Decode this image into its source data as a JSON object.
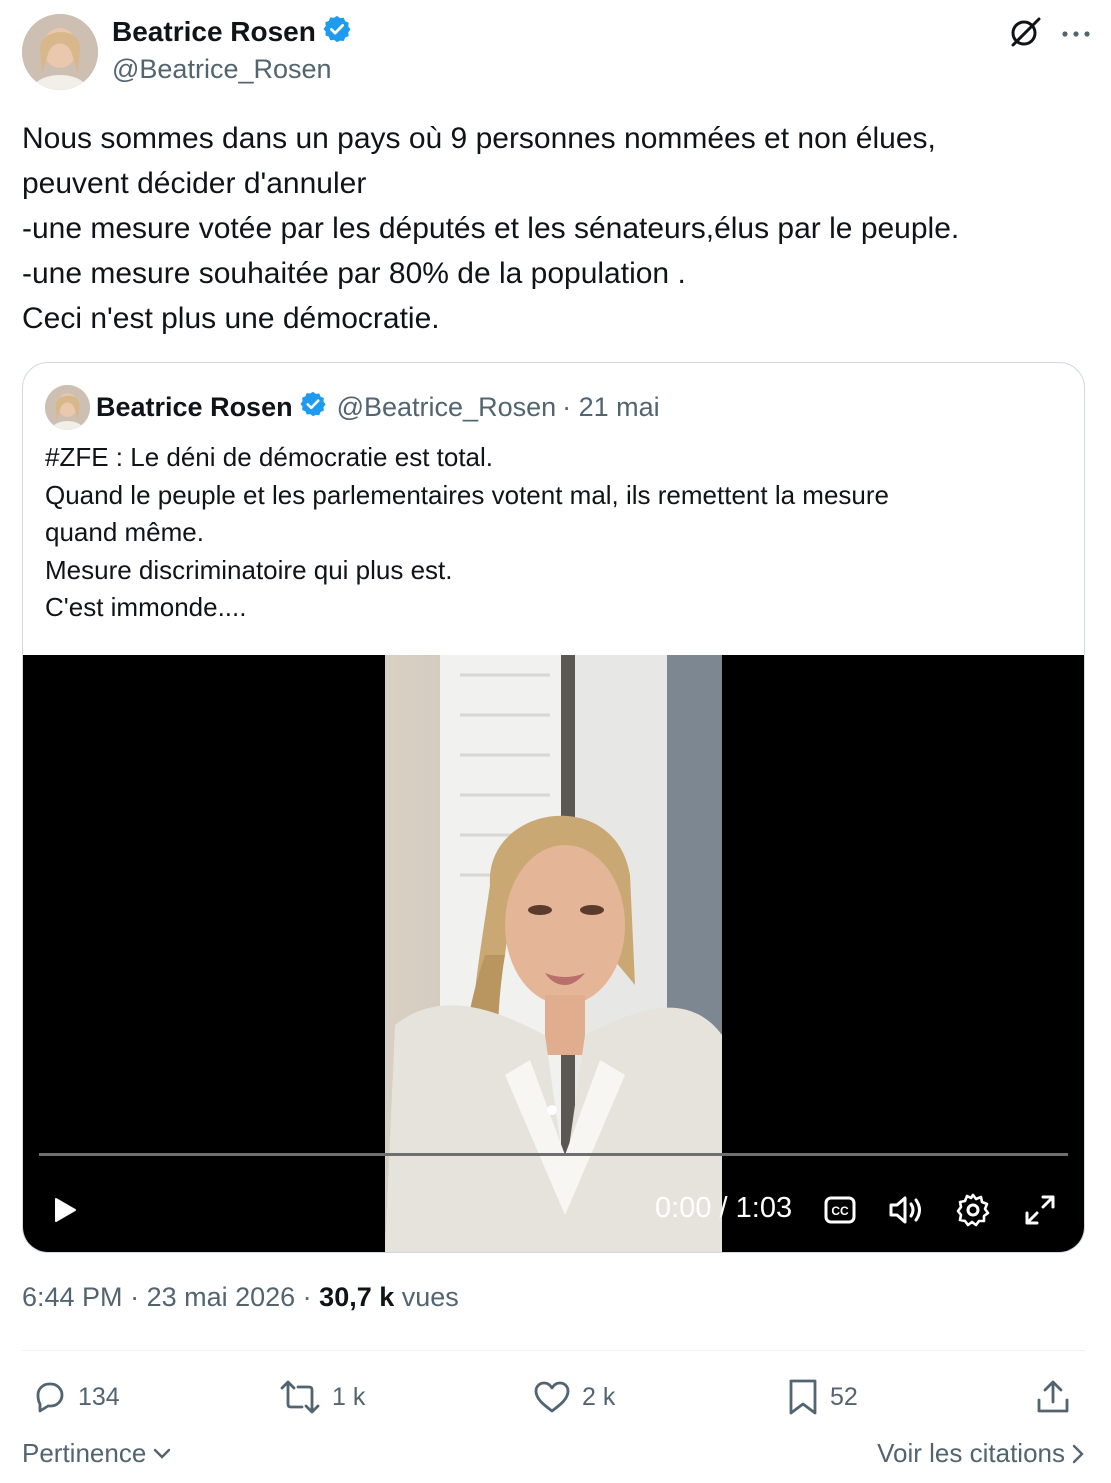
{
  "author": {
    "name": "Beatrice Rosen",
    "handle": "@Beatrice_Rosen",
    "verified": true,
    "verified_color": "#1d9bf0"
  },
  "header_icons": [
    "grok-icon",
    "more-icon"
  ],
  "tweet": {
    "lines": [
      "Nous sommes dans un pays où 9 personnes nommées et non élues,",
      "peuvent décider d'annuler",
      "-une mesure votée par les députés et les sénateurs,élus par le peuple.",
      "-une mesure souhaitée par 80% de la population .",
      "Ceci n'est plus une démocratie."
    ]
  },
  "quoted": {
    "name": "Beatrice Rosen",
    "handle": "@Beatrice_Rosen",
    "date": "· 21 mai",
    "lines": [
      "#ZFE : Le déni de démocratie est total.",
      "Quand le peuple et les parlementaires votent mal, ils remettent la mesure",
      "quand même.",
      "Mesure discriminatoire qui plus est.",
      "C'est immonde...."
    ],
    "video": {
      "current_time": "0:00",
      "separator": "/",
      "duration": "1:03",
      "progress": 0
    }
  },
  "meta": {
    "time": "6:44 PM",
    "sep1": " · ",
    "date": "23 mai 2026",
    "sep2": " · ",
    "views_count": "30,7 k",
    "views_label": " vues"
  },
  "actions": {
    "replies": "134",
    "reposts": "1 k",
    "likes": "2 k",
    "bookmarks": "52"
  },
  "footer": {
    "sort_label": "Pertinence",
    "quotes_link": "Voir les citations"
  },
  "colors": {
    "text": "#0f1419",
    "secondary": "#536471",
    "border": "#cfd9de",
    "accent": "#1d9bf0"
  }
}
